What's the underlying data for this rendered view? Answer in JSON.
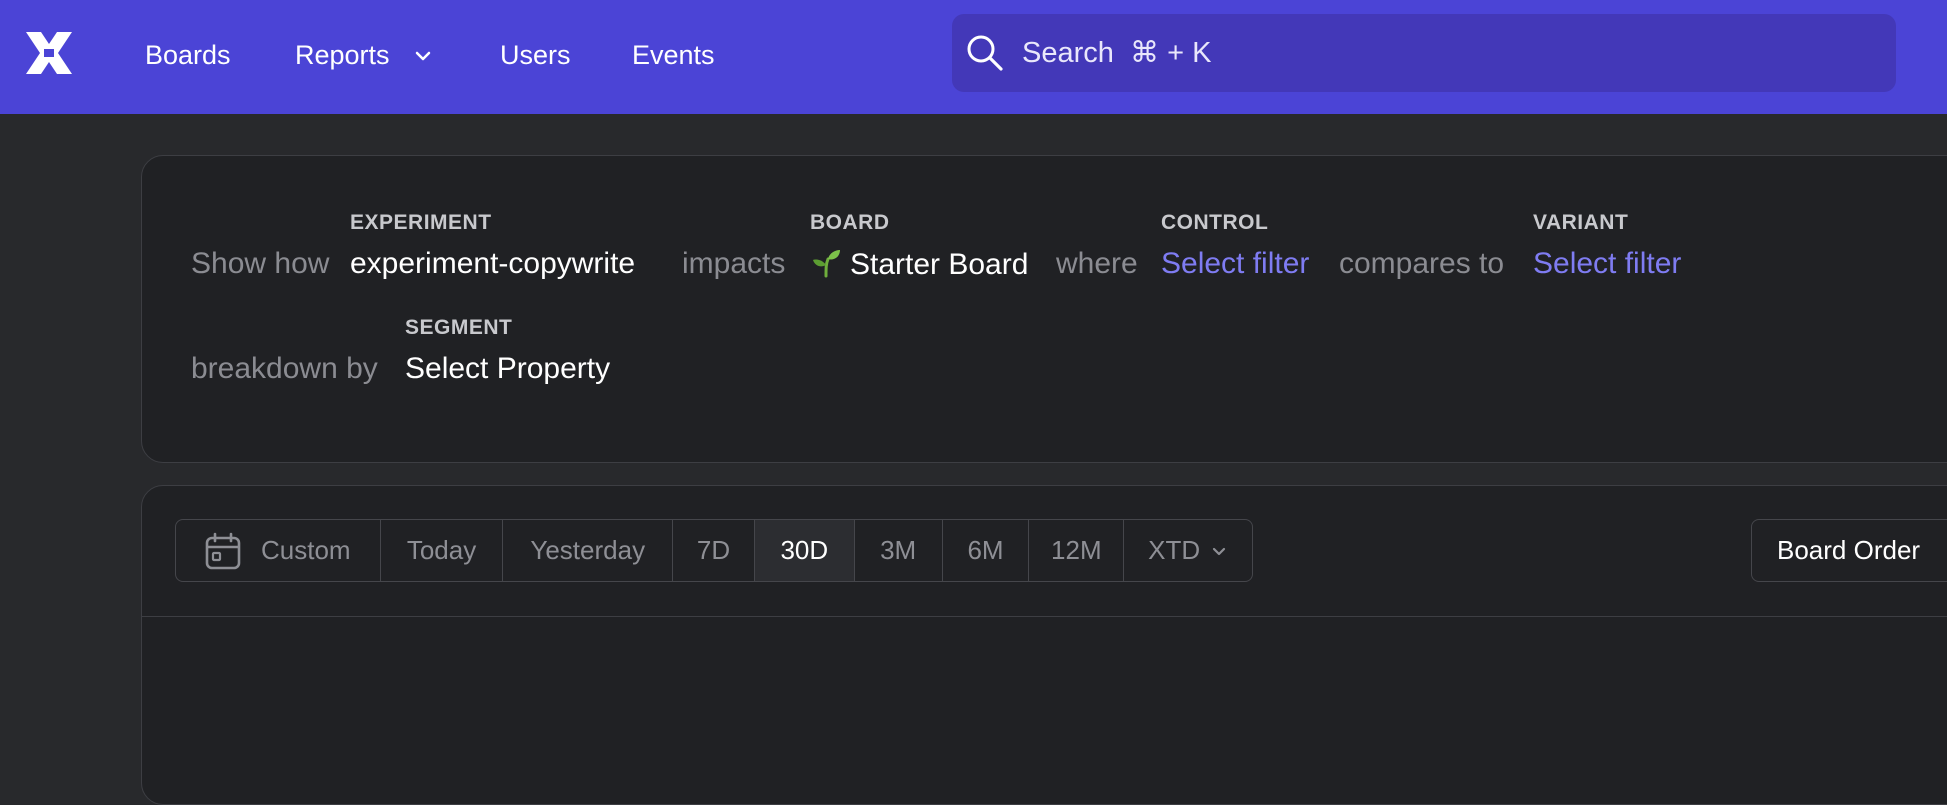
{
  "nav": {
    "logo_icon": "x-logo-icon",
    "items": [
      {
        "label": "Boards"
      },
      {
        "label": "Reports",
        "has_dropdown": true
      },
      {
        "label": "Users"
      },
      {
        "label": "Events"
      }
    ],
    "search": {
      "label": "Search",
      "shortcut": "⌘ + K",
      "icon": "search-icon"
    }
  },
  "query": {
    "show_how": "Show how",
    "experiment_label": "EXPERIMENT",
    "experiment_value": "experiment-copywrite",
    "impacts": "impacts",
    "board_label": "BOARD",
    "board_emoji": "seedling-icon",
    "board_value": "Starter Board",
    "where": "where",
    "control_label": "CONTROL",
    "control_value": "Select filter",
    "compares_to": "compares to",
    "variant_label": "VARIANT",
    "variant_value": "Select filter",
    "breakdown_by": "breakdown by",
    "segment_label": "SEGMENT",
    "segment_value": "Select Property"
  },
  "date_range": {
    "options": [
      "Custom",
      "Today",
      "Yesterday",
      "7D",
      "30D",
      "3M",
      "6M",
      "12M",
      "XTD"
    ],
    "selected": "30D"
  },
  "sort": {
    "label": "Board Order"
  },
  "colors": {
    "nav_bg": "#4b44d6",
    "search_bg": "#4338b8",
    "page_bg": "#28292c",
    "panel_bg": "#202124",
    "link": "#7f7cf2"
  }
}
